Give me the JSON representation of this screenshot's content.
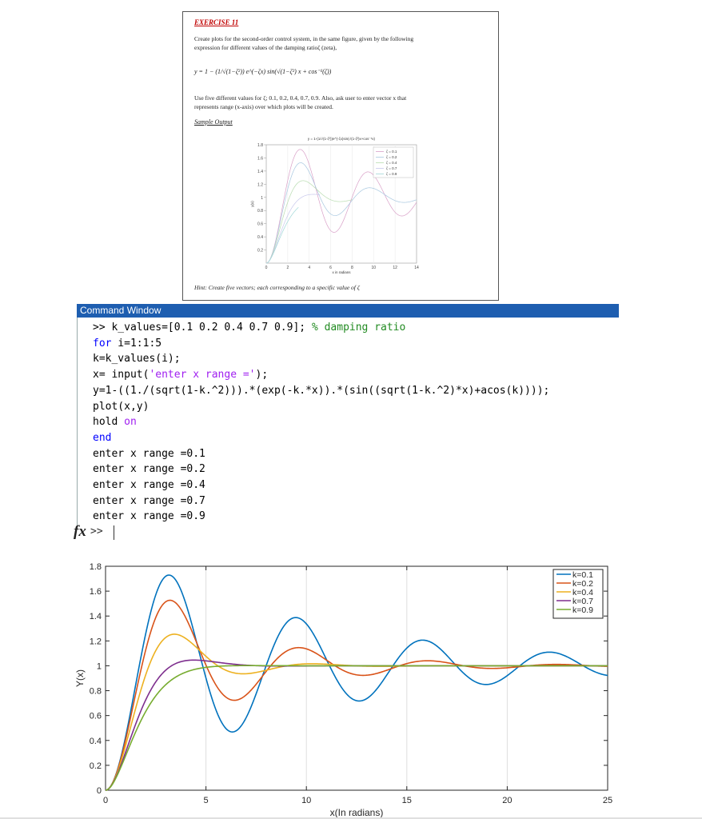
{
  "exercise": {
    "title": "EXERCISE 11",
    "intro_line1": "Create plots for the second-order control system, in the same figure, given by the following",
    "intro_line2": "expression for different values of the damping ratioζ (zeta),",
    "formula": "y = 1 − (1/√(1−ζ²)) e^(−ζx) sin(√(1−ζ²) x + cos⁻¹(ζ))",
    "use_line1": "Use five different values for ζ; 0.1, 0.2, 0.4, 0.7, 0.9. Also, ask user to enter vector x that",
    "use_line2": "represents range (x-axis) over which plots will be created.",
    "sample_label": "Sample Output",
    "hint": "Hint: Create five vectors; each corresponding to a specific value of ζ"
  },
  "mini_chart": {
    "title": "y = 1-(1/√(1-ζ²))e^(-ζx)sin(√(1-ζ²)x+cos⁻¹x)",
    "xlabel": "x in radians",
    "ylabel": "y(x)",
    "legend": [
      "ζ = 0.1",
      "ζ = 0.2",
      "ζ = 0.4",
      "ζ = 0.7",
      "ζ = 0.9"
    ],
    "xticks": [
      "0",
      "2",
      "4",
      "6",
      "8",
      "10",
      "12",
      "14"
    ],
    "yticks": [
      "0.2",
      "0.4",
      "0.6",
      "0.8",
      "1",
      "1.2",
      "1.4",
      "1.6",
      "1.8"
    ],
    "colors": [
      "#d9a0c8",
      "#a8c8e0",
      "#b8dcb0",
      "#c8c8ec",
      "#a0d8d8"
    ]
  },
  "command_window": {
    "title": "Command Window",
    "prompt": ">>",
    "fx_symbol": "fx",
    "lines": [
      [
        {
          "t": ">> k_values=[0.1 0.2 0.4 0.7 0.9]; ",
          "c": ""
        },
        {
          "t": "% damping ratio",
          "c": "cmt"
        }
      ],
      [
        {
          "t": "for",
          "c": "kw"
        },
        {
          "t": " i=1:1:5",
          "c": ""
        }
      ],
      [
        {
          "t": "k=k_values(i);",
          "c": ""
        }
      ],
      [
        {
          "t": "x= input(",
          "c": ""
        },
        {
          "t": "'enter x range ='",
          "c": "str"
        },
        {
          "t": ");",
          "c": ""
        }
      ],
      [
        {
          "t": "y=1-((1./(sqrt(1-k.^2))).*(exp(-k.*x)).*(sin((sqrt(1-k.^2)*x)+acos(k))));",
          "c": ""
        }
      ],
      [
        {
          "t": "plot(x,y)",
          "c": ""
        }
      ],
      [
        {
          "t": "hold ",
          "c": ""
        },
        {
          "t": "on",
          "c": "str"
        }
      ],
      [
        {
          "t": "end",
          "c": "kw"
        }
      ],
      [
        {
          "t": "enter x range =0.1",
          "c": ""
        }
      ],
      [
        {
          "t": "enter x range =0.2",
          "c": ""
        }
      ],
      [
        {
          "t": "enter x range =0.4",
          "c": ""
        }
      ],
      [
        {
          "t": "enter x range =0.7",
          "c": ""
        }
      ],
      [
        {
          "t": "enter x range =0.9",
          "c": ""
        }
      ]
    ]
  },
  "chart_data": {
    "type": "line",
    "title": "",
    "xlabel": "x(In radians)",
    "ylabel": "Y(x)",
    "xlim": [
      0,
      25
    ],
    "ylim": [
      0,
      1.8
    ],
    "xticks": [
      0,
      5,
      10,
      15,
      20,
      25
    ],
    "yticks": [
      0,
      0.2,
      0.4,
      0.6,
      0.8,
      1,
      1.2,
      1.4,
      1.6,
      1.8
    ],
    "grid": "vertical",
    "legend_position": "top-right",
    "formula": "y = 1 - (1/sqrt(1-k^2)) * exp(-k*x) * sin(sqrt(1-k^2)*x + acos(k))",
    "series": [
      {
        "name": "k=0.1",
        "k": 0.1,
        "color": "#0072bd",
        "points": [
          [
            0,
            0
          ],
          [
            1,
            0.44
          ],
          [
            2,
            1.22
          ],
          [
            3,
            1.72
          ],
          [
            4,
            1.52
          ],
          [
            5,
            0.88
          ],
          [
            6,
            0.49
          ],
          [
            7,
            0.62
          ],
          [
            8,
            1.07
          ],
          [
            9,
            1.37
          ],
          [
            10,
            1.3
          ],
          [
            11,
            0.96
          ],
          [
            12,
            0.76
          ],
          [
            13,
            0.82
          ],
          [
            14,
            1.07
          ],
          [
            15,
            1.22
          ],
          [
            16,
            1.14
          ],
          [
            17,
            0.95
          ],
          [
            18,
            0.86
          ],
          [
            19,
            0.89
          ],
          [
            20,
            1.03
          ],
          [
            21,
            1.1
          ],
          [
            22,
            1.07
          ],
          [
            23,
            0.98
          ],
          [
            24,
            0.93
          ],
          [
            25,
            0.94
          ]
        ]
      },
      {
        "name": "k=0.2",
        "k": 0.2,
        "color": "#d95319",
        "points": [
          [
            0,
            0
          ],
          [
            1,
            0.42
          ],
          [
            2,
            1.13
          ],
          [
            3,
            1.51
          ],
          [
            4,
            1.3
          ],
          [
            5,
            0.88
          ],
          [
            6,
            0.73
          ],
          [
            7,
            0.86
          ],
          [
            8,
            1.06
          ],
          [
            9,
            1.15
          ],
          [
            10,
            1.1
          ],
          [
            11,
            0.98
          ],
          [
            12,
            0.94
          ],
          [
            13,
            0.96
          ],
          [
            14,
            1.02
          ],
          [
            15,
            1.04
          ],
          [
            16,
            1.02
          ],
          [
            17,
            0.99
          ],
          [
            18,
            0.99
          ],
          [
            19,
            0.99
          ],
          [
            20,
            1.0
          ],
          [
            21,
            1.01
          ],
          [
            22,
            1.01
          ],
          [
            23,
            1.0
          ],
          [
            24,
            1.0
          ],
          [
            25,
            1.0
          ]
        ]
      },
      {
        "name": "k=0.4",
        "k": 0.4,
        "color": "#edb120",
        "points": [
          [
            0,
            0
          ],
          [
            1,
            0.39
          ],
          [
            2,
            0.96
          ],
          [
            3,
            1.24
          ],
          [
            4,
            1.17
          ],
          [
            5,
            1.01
          ],
          [
            6,
            0.94
          ],
          [
            7,
            0.96
          ],
          [
            8,
            1.0
          ],
          [
            9,
            1.02
          ],
          [
            10,
            1.01
          ],
          [
            11,
            1.0
          ],
          [
            12,
            1.0
          ],
          [
            13,
            1.0
          ],
          [
            14,
            1.0
          ],
          [
            15,
            1.0
          ],
          [
            16,
            1.0
          ],
          [
            17,
            1.0
          ],
          [
            18,
            1.0
          ],
          [
            19,
            1.0
          ],
          [
            20,
            1.0
          ],
          [
            21,
            1.0
          ],
          [
            22,
            1.0
          ],
          [
            23,
            1.0
          ],
          [
            24,
            1.0
          ],
          [
            25,
            1.0
          ]
        ]
      },
      {
        "name": "k=0.7",
        "k": 0.7,
        "color": "#7e2f8e",
        "points": [
          [
            0,
            0
          ],
          [
            1,
            0.33
          ],
          [
            2,
            0.77
          ],
          [
            3,
            1.0
          ],
          [
            4,
            1.05
          ],
          [
            5,
            1.03
          ],
          [
            6,
            1.01
          ],
          [
            7,
            1.0
          ],
          [
            8,
            1.0
          ],
          [
            9,
            1.0
          ],
          [
            10,
            1.0
          ],
          [
            11,
            1.0
          ],
          [
            12,
            1.0
          ],
          [
            13,
            1.0
          ],
          [
            14,
            1.0
          ],
          [
            15,
            1.0
          ],
          [
            16,
            1.0
          ],
          [
            17,
            1.0
          ],
          [
            18,
            1.0
          ],
          [
            19,
            1.0
          ],
          [
            20,
            1.0
          ],
          [
            21,
            1.0
          ],
          [
            22,
            1.0
          ],
          [
            23,
            1.0
          ],
          [
            24,
            1.0
          ],
          [
            25,
            1.0
          ]
        ]
      },
      {
        "name": "k=0.9",
        "k": 0.9,
        "color": "#77ac30",
        "points": [
          [
            0,
            0
          ],
          [
            1,
            0.26
          ],
          [
            2,
            0.62
          ],
          [
            3,
            0.85
          ],
          [
            4,
            0.95
          ],
          [
            5,
            0.99
          ],
          [
            6,
            1.0
          ],
          [
            7,
            1.0
          ],
          [
            8,
            1.0
          ],
          [
            9,
            1.0
          ],
          [
            10,
            1.0
          ],
          [
            11,
            1.0
          ],
          [
            12,
            1.0
          ],
          [
            13,
            1.0
          ],
          [
            14,
            1.0
          ],
          [
            15,
            1.0
          ],
          [
            16,
            1.0
          ],
          [
            17,
            1.0
          ],
          [
            18,
            1.0
          ],
          [
            19,
            1.0
          ],
          [
            20,
            1.0
          ],
          [
            21,
            1.0
          ],
          [
            22,
            1.0
          ],
          [
            23,
            1.0
          ],
          [
            24,
            1.0
          ],
          [
            25,
            1.0
          ]
        ]
      }
    ]
  }
}
